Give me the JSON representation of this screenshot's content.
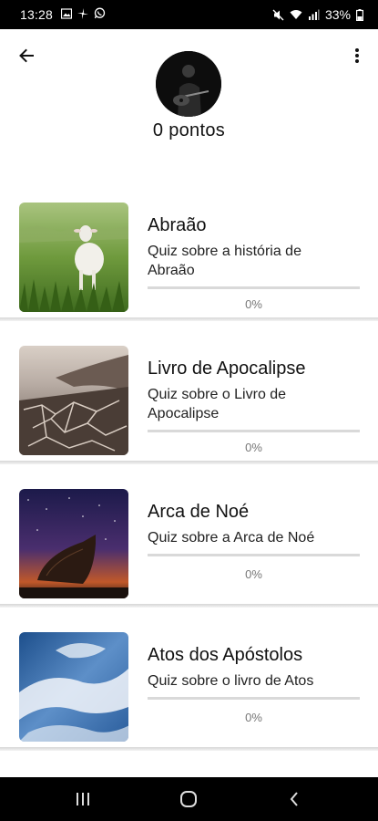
{
  "status_bar": {
    "time": "13:28",
    "battery": "33%",
    "left_icons": [
      "image-icon",
      "pinwheel-icon",
      "whatsapp-icon"
    ],
    "right_icons": [
      "mute-icon",
      "wifi-icon",
      "signal-icon",
      "battery-icon"
    ]
  },
  "header": {
    "back_icon": "arrow-left-icon",
    "menu_icon": "more-vert-icon",
    "points_text": "0 pontos"
  },
  "quizzes": [
    {
      "title": "Abraão",
      "description": "Quiz sobre a história de Abraão",
      "progress_label": "0%",
      "progress": 0,
      "image": "lamb-in-grass"
    },
    {
      "title": "Livro de Apocalipse",
      "description": "Quiz sobre o Livro de Apocalipse",
      "progress_label": "0%",
      "progress": 0,
      "image": "cracked-earth"
    },
    {
      "title": "Arca de Noé",
      "description": "Quiz sobre a Arca de Noé",
      "progress_label": "0%",
      "progress": 0,
      "image": "boat-under-stars"
    },
    {
      "title": "Atos dos Apóstolos",
      "description": "Quiz sobre o livro de Atos",
      "progress_label": "0%",
      "progress": 0,
      "image": "clouds-sky"
    }
  ],
  "nav_bar": {
    "icons": [
      "recents-icon",
      "home-icon",
      "back-icon"
    ]
  },
  "colors": {
    "status_bar": "#000000",
    "background": "#ffffff",
    "progress_track": "#d9d9d9",
    "text": "#111111"
  }
}
